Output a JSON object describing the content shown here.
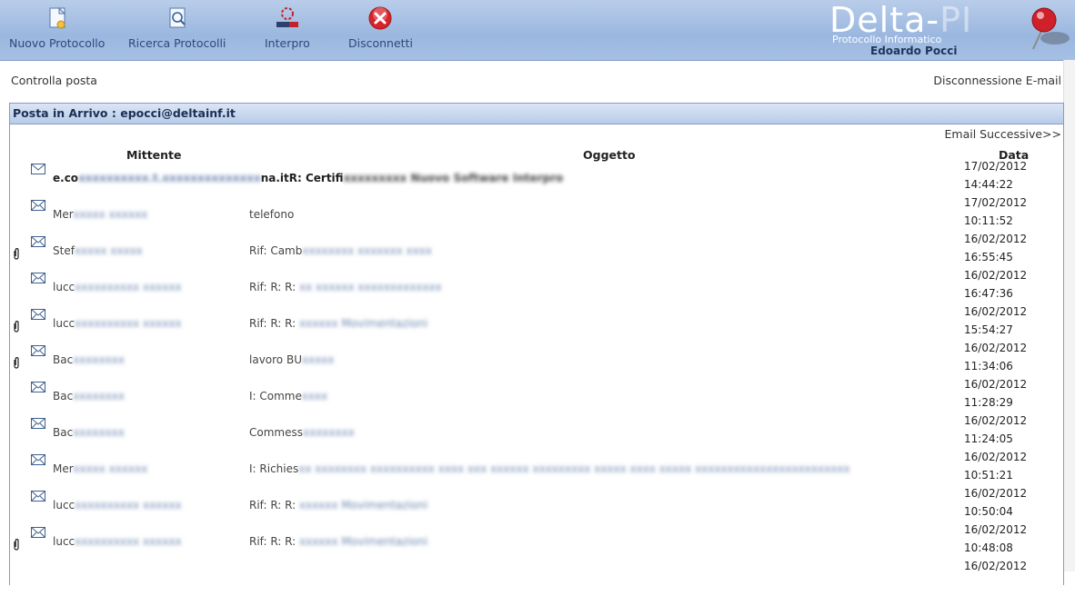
{
  "toolbar": {
    "buttons": [
      {
        "label": "Nuovo Protocollo",
        "icon": "new-document-icon"
      },
      {
        "label": "Ricerca Protocolli",
        "icon": "search-document-icon"
      },
      {
        "label": "Interpro",
        "icon": "interpro-logo-icon"
      },
      {
        "label": "Disconnetti",
        "icon": "close-icon"
      }
    ]
  },
  "logo": {
    "title_a": "Delta-",
    "title_b": "PI",
    "subtitle": "Protocollo Informatico",
    "user": "Edoardo Pocci"
  },
  "links": {
    "check_mail": "Controlla posta",
    "disconnect_email": "Disconnessione E-mail"
  },
  "inbox": {
    "title": "Posta in Arrivo : epocci@deltainf.it",
    "next_label": "Email Successive>>",
    "columns": {
      "sender": "Mittente",
      "subject": "Oggetto",
      "date": "Data"
    },
    "rows": [
      {
        "attachment": false,
        "sender": "e.co",
        "sender_blur": "xxxxxxxxxx.t.xxxxxxxxxxxxxx",
        "sender_tail": "na.itR: Certifi",
        "subject": "",
        "subject_blur": "xxxxxxxxx Nuovo Software Interpro",
        "date": "17/02/2012",
        "time": "14:44:22"
      },
      {
        "attachment": false,
        "sender": "Mer",
        "sender_blur": "xxxxx xxxxxx",
        "subject": "telefono",
        "subject_blur": "",
        "date": "17/02/2012",
        "time": "10:11:52"
      },
      {
        "attachment": true,
        "sender": "Stef",
        "sender_blur": "xxxxx xxxxx",
        "subject": "Rif: Camb",
        "subject_blur": "xxxxxxxx xxxxxxx xxxx",
        "date": "16/02/2012",
        "time": "16:55:45"
      },
      {
        "attachment": false,
        "sender": "lucc",
        "sender_blur": "xxxxxxxxxx xxxxxx",
        "subject": "Rif: R: R: ",
        "subject_blur": "xx xxxxxx xxxxxxxxxxxxx",
        "date": "16/02/2012",
        "time": "16:47:36"
      },
      {
        "attachment": true,
        "sender": "lucc",
        "sender_blur": "xxxxxxxxxx xxxxxx",
        "subject": "Rif: R: R: ",
        "subject_blur": "xxxxxx Movimentazioni",
        "date": "16/02/2012",
        "time": "15:54:27"
      },
      {
        "attachment": true,
        "sender": "Bac",
        "sender_blur": "xxxxxxxx",
        "subject": "lavoro BU",
        "subject_blur": "xxxxx",
        "date": "16/02/2012",
        "time": "11:34:06"
      },
      {
        "attachment": false,
        "sender": "Bac",
        "sender_blur": "xxxxxxxx",
        "subject": "I: Comme",
        "subject_blur": "xxxx",
        "date": "16/02/2012",
        "time": "11:28:29"
      },
      {
        "attachment": false,
        "sender": "Bac",
        "sender_blur": "xxxxxxxx",
        "subject": "Commess",
        "subject_blur": "xxxxxxxx",
        "date": "16/02/2012",
        "time": "11:24:05"
      },
      {
        "attachment": false,
        "sender": "Mer",
        "sender_blur": "xxxxx xxxxxx",
        "subject": "I: Richies",
        "subject_blur": "xx xxxxxxxx xxxxxxxxxx xxxx xxx xxxxxx xxxxxxxxx xxxxx xxxx xxxxx xxxxxxxxxxxxxxxxxxxxxxxx",
        "date": "16/02/2012",
        "time": "10:51:21"
      },
      {
        "attachment": false,
        "sender": "lucc",
        "sender_blur": "xxxxxxxxxx xxxxxx",
        "subject": "Rif: R: R: ",
        "subject_blur": "xxxxxx Movimentazioni",
        "date": "16/02/2012",
        "time": "10:50:04"
      },
      {
        "attachment": true,
        "sender": "lucc",
        "sender_blur": "xxxxxxxxxx xxxxxx",
        "subject": "Rif: R: R: ",
        "subject_blur": "xxxxxx Movimentazioni",
        "date": "16/02/2012",
        "time": "10:48:08"
      },
      {
        "attachment": false,
        "sender": "",
        "sender_blur": "",
        "subject": "",
        "subject_blur": "",
        "date": "16/02/2012",
        "time": ""
      }
    ]
  },
  "colors": {
    "toolbar": "#9ab7df",
    "header": "#b8cbe8",
    "border": "#7f9cc9",
    "accent_text": "#2b4a7c"
  }
}
